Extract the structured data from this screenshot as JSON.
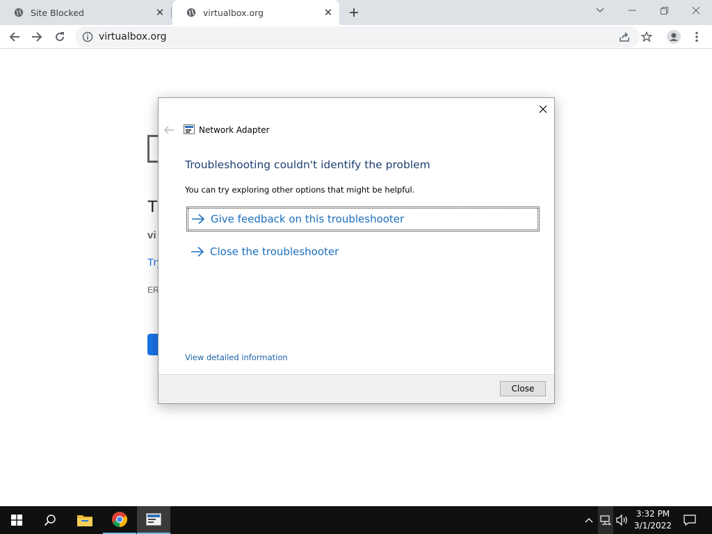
{
  "browser": {
    "tabs": [
      {
        "title": "Site Blocked",
        "active": false
      },
      {
        "title": "virtualbox.org",
        "active": true
      }
    ],
    "url": "virtualbox.org"
  },
  "background_page": {
    "heading": "T",
    "host": "vi",
    "try": "Try",
    "error_code": "ERI"
  },
  "dialog": {
    "app_title": "Network Adapter",
    "heading": "Troubleshooting couldn't identify the problem",
    "subtext": "You can try exploring other options that might be helpful.",
    "options": [
      {
        "label": "Give feedback on this troubleshooter",
        "focused": true
      },
      {
        "label": "Close the troubleshooter",
        "focused": false
      }
    ],
    "details_link": "View detailed information",
    "close_button": "Close"
  },
  "taskbar": {
    "time": "3:32 PM",
    "date": "3/1/2022",
    "pinned": [
      "start-icon",
      "search-icon",
      "file-explorer-icon",
      "chrome-icon",
      "troubleshooter-icon"
    ]
  },
  "colors": {
    "accent_link": "#1a6ebd",
    "heading_blue": "#1e3f73",
    "taskbar_bg": "#101010"
  }
}
